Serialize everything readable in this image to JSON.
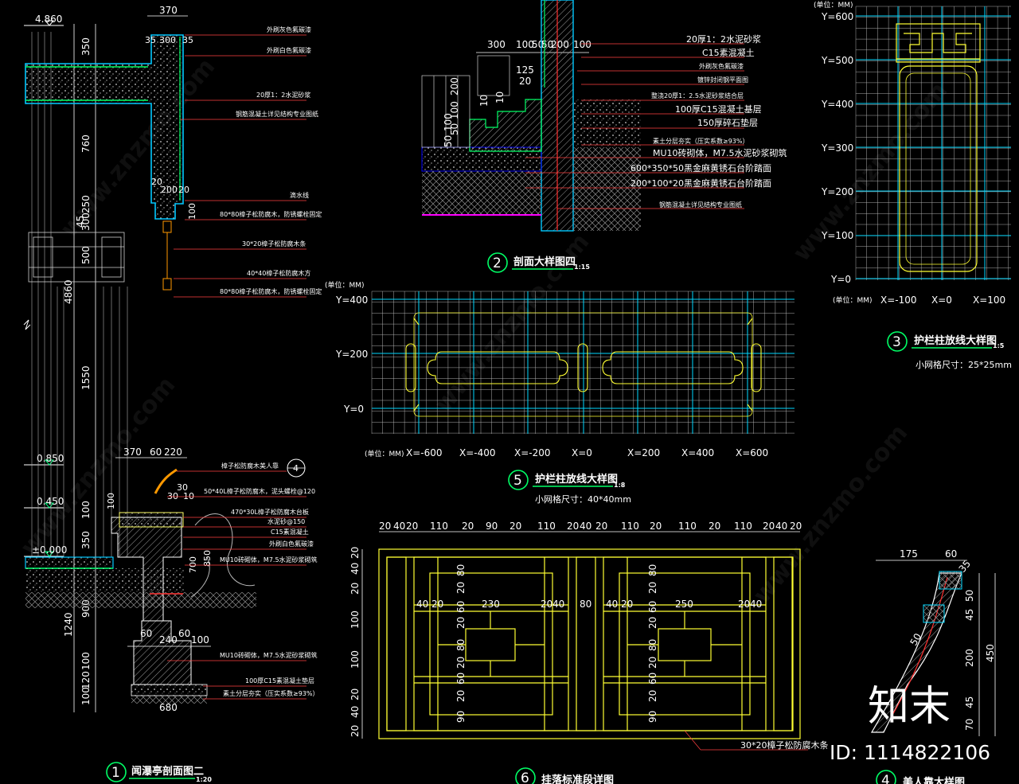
{
  "watermark": {
    "id_label": "ID: 1114822106",
    "brand_cn": "知末",
    "site": "www.znzmo.com"
  },
  "drawing1": {
    "title": "闻瀑亭剖面图二",
    "number": "1",
    "scale": "1:20",
    "top_dims": [
      "370",
      "35",
      "300",
      "35"
    ],
    "left_dims": [
      "350",
      "760",
      "250",
      "45",
      "300",
      "500",
      "4860",
      "1550",
      "100",
      "350",
      "900",
      "1240",
      "100",
      "120",
      "100"
    ],
    "mid_dims": [
      "20",
      "200",
      "20",
      "100"
    ],
    "levels": [
      "4.860",
      "0.850",
      "0.450",
      "±0.000"
    ],
    "bottom_dims": [
      "370",
      "60",
      "220",
      "60",
      "240",
      "60",
      "100",
      "680"
    ],
    "detail_ref": "4",
    "notes_top": [
      "外刷灰色氟碳漆",
      "外刷白色氟碳漆",
      "20厚1：2水泥砂浆",
      "钢筋混凝土详见结构专业图纸",
      "滴水线",
      "80*80樟子松防腐木，防锈螺栓固定",
      "30*20樟子松防腐木条",
      "40*40樟子松防腐木方",
      "80*80樟子松防腐木，防锈螺栓固定"
    ],
    "notes_bottom": [
      "樟子松防腐木美人靠",
      "50*40L樟子松防腐木，泥头螺栓@120",
      "470*30L樟子松防腐木台板",
      "水泥砂@150",
      "C15素混凝土",
      "外刷白色氟碳漆",
      "MU10砖砌体，M7.5水泥砂浆砌筑",
      "MU10砖砌体，M7.5水泥砂浆砌筑",
      "100厚C15素混凝土垫层",
      "素土分层夯实（压实系数≥93%）"
    ],
    "bench_dims": [
      "30",
      "100",
      "30",
      "10",
      "700",
      "850"
    ]
  },
  "drawing2": {
    "title": "剖面大样图四",
    "number": "2",
    "scale": "1:15",
    "top_dims": [
      "300",
      "100",
      "50",
      "50",
      "200",
      "100"
    ],
    "side_dims": [
      "200",
      "100",
      "50",
      "100",
      "50",
      "100",
      "50",
      "125",
      "20",
      "10",
      "10"
    ],
    "notes": [
      "20厚1：2水泥砂浆",
      "C15素混凝土",
      "外刷灰色氟碳漆",
      "镀锌封闭钢平面图",
      "整浇20厚1：2.5水泥砂浆结合层",
      "100厚C15混凝土基层",
      "150厚碎石垫层",
      "素土分层夯实（压实系数≥93%）",
      "MU10砖砌体，M7.5水泥砂浆砌筑",
      "600*350*50黑金麻黄锈石台阶踏面",
      "200*100*20黑金麻黄锈石台阶踏面",
      "钢筋混凝土详见结构专业图纸"
    ]
  },
  "drawing3": {
    "title": "护栏柱放线大样图",
    "number": "3",
    "scale": "1:5",
    "unit": "(单位：MM)",
    "y_labels": [
      "Y=600",
      "Y=500",
      "Y=400",
      "Y=300",
      "Y=200",
      "Y=100",
      "Y=0"
    ],
    "x_labels": [
      "X=-100",
      "X=0",
      "X=100"
    ],
    "unit_bottom": "(单位：MM)",
    "grid_note": "小网格尺寸：25*25mm"
  },
  "drawing5": {
    "title": "护栏柱放线大样图",
    "number": "5",
    "scale": "1:8",
    "unit": "(单位：MM)",
    "y_labels": [
      "Y=400",
      "Y=200",
      "Y=0"
    ],
    "x_labels": [
      "X=-600",
      "X=-400",
      "X=-200",
      "X=0",
      "X=200",
      "X=400",
      "X=600"
    ],
    "unit_bottom": "(单位：MM)",
    "grid_note": "小网格尺寸：40*40mm"
  },
  "drawing6": {
    "title": "挂落标准段详图",
    "number": "6",
    "top_dims": [
      "20",
      "40",
      "20",
      "110",
      "20",
      "90",
      "20",
      "110",
      "20",
      "40",
      "20",
      "110",
      "20",
      "110",
      "20",
      "110",
      "20",
      "40",
      "20"
    ],
    "inner_dims": [
      "40",
      "20",
      "230",
      "20",
      "40",
      "80",
      "40",
      "20",
      "250",
      "20",
      "40"
    ],
    "left_dims": [
      "20",
      "40",
      "20",
      "100",
      "100",
      "20",
      "40",
      "20"
    ],
    "v_dims_a": [
      "80",
      "20",
      "60",
      "20",
      "80",
      "20",
      "60",
      "20",
      "90"
    ],
    "note": "30*20樟子松防腐木条"
  },
  "drawing4": {
    "title": "美人靠大样图",
    "number": "4",
    "top_dims": [
      "175",
      "60"
    ],
    "right_dims": [
      "50",
      "45",
      "200",
      "45",
      "70",
      "450"
    ],
    "misc": [
      "35",
      "50"
    ]
  }
}
